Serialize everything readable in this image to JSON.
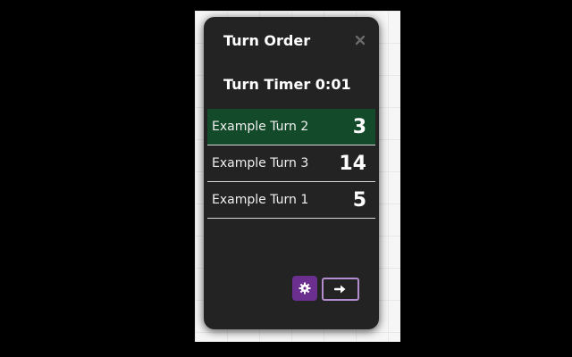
{
  "panel": {
    "title": "Turn Order",
    "timer": "Turn Timer 0:01",
    "close_icon": "close-icon"
  },
  "turns": [
    {
      "name": "Example Turn 2",
      "initiative": "3",
      "active": true
    },
    {
      "name": "Example Turn 3",
      "initiative": "14",
      "active": false
    },
    {
      "name": "Example Turn 1",
      "initiative": "5",
      "active": false
    }
  ],
  "controls": {
    "settings_icon": "gear-icon",
    "next_icon": "arrow-right-icon"
  },
  "colors": {
    "panel_bg": "#232323",
    "active_row": "#124a2a",
    "settings_button": "#6b2f8f",
    "next_button_border": "#b48cd0"
  }
}
